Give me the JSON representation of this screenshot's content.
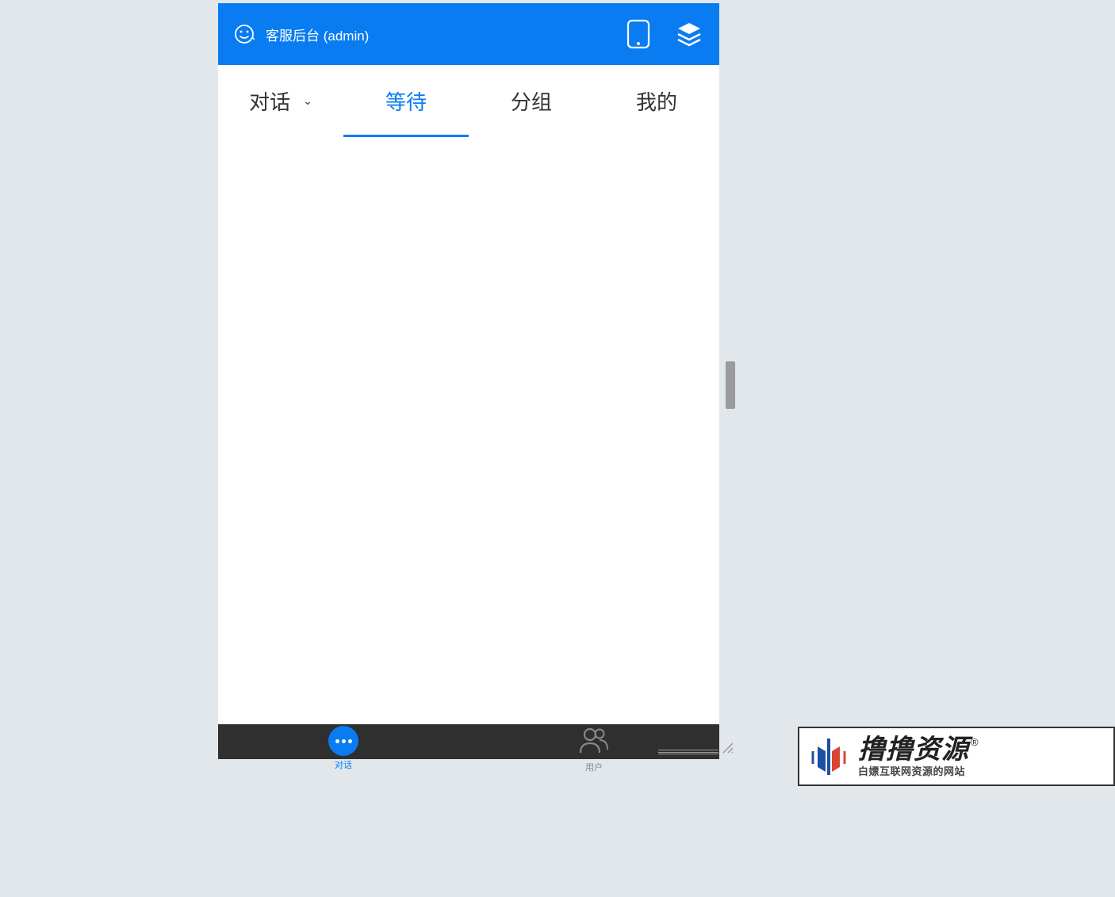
{
  "header": {
    "title": "客服后台  (admin)"
  },
  "tabs": [
    {
      "label": "对话",
      "has_dropdown": true,
      "active": false
    },
    {
      "label": "等待",
      "has_dropdown": false,
      "active": true
    },
    {
      "label": "分组",
      "has_dropdown": false,
      "active": false
    },
    {
      "label": "我的",
      "has_dropdown": false,
      "active": false
    }
  ],
  "bottom_nav": {
    "chat_label": "对话",
    "user_label": "用户"
  },
  "watermark": {
    "main": "撸撸资源",
    "reg": "®",
    "sub": "白嫖互联网资源的网站"
  }
}
